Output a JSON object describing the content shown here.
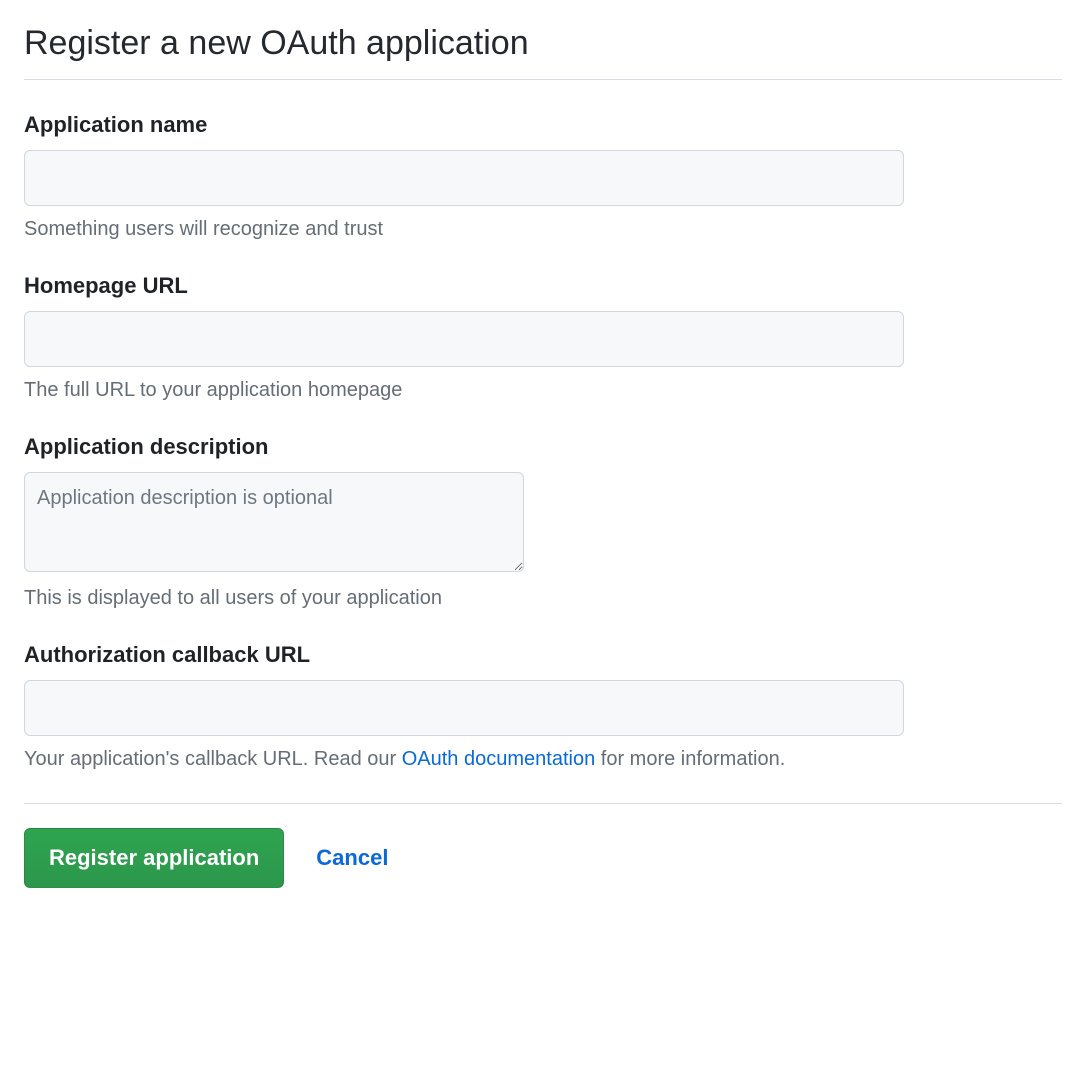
{
  "header": {
    "title": "Register a new OAuth application"
  },
  "form": {
    "app_name": {
      "label": "Application name",
      "value": "",
      "note": "Something users will recognize and trust"
    },
    "homepage_url": {
      "label": "Homepage URL",
      "value": "",
      "note": "The full URL to your application homepage"
    },
    "app_description": {
      "label": "Application description",
      "value": "",
      "placeholder": "Application description is optional",
      "note": "This is displayed to all users of your application"
    },
    "callback_url": {
      "label": "Authorization callback URL",
      "value": "",
      "note_prefix": "Your application's callback URL. Read our ",
      "note_link_text": "OAuth documentation",
      "note_suffix": " for more information."
    }
  },
  "actions": {
    "submit_label": "Register application",
    "cancel_label": "Cancel"
  }
}
